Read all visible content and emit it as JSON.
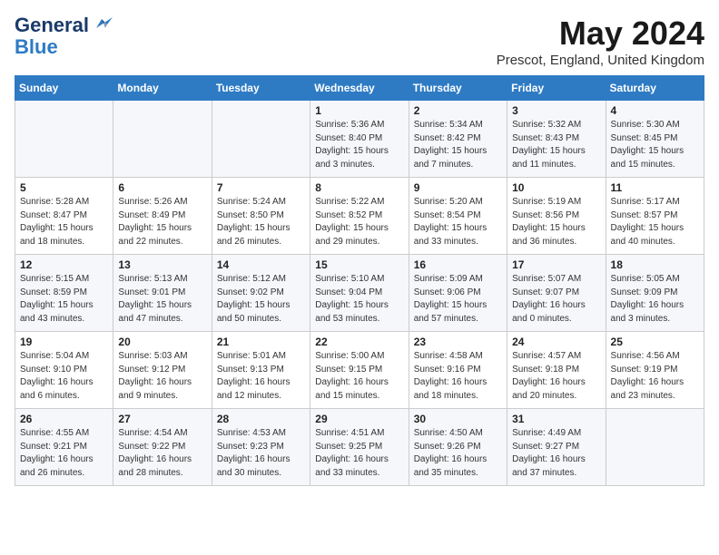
{
  "logo": {
    "line1": "General",
    "line2": "Blue"
  },
  "title": "May 2024",
  "location": "Prescot, England, United Kingdom",
  "days_header": [
    "Sunday",
    "Monday",
    "Tuesday",
    "Wednesday",
    "Thursday",
    "Friday",
    "Saturday"
  ],
  "weeks": [
    [
      {
        "day": "",
        "content": ""
      },
      {
        "day": "",
        "content": ""
      },
      {
        "day": "",
        "content": ""
      },
      {
        "day": "1",
        "content": "Sunrise: 5:36 AM\nSunset: 8:40 PM\nDaylight: 15 hours\nand 3 minutes."
      },
      {
        "day": "2",
        "content": "Sunrise: 5:34 AM\nSunset: 8:42 PM\nDaylight: 15 hours\nand 7 minutes."
      },
      {
        "day": "3",
        "content": "Sunrise: 5:32 AM\nSunset: 8:43 PM\nDaylight: 15 hours\nand 11 minutes."
      },
      {
        "day": "4",
        "content": "Sunrise: 5:30 AM\nSunset: 8:45 PM\nDaylight: 15 hours\nand 15 minutes."
      }
    ],
    [
      {
        "day": "5",
        "content": "Sunrise: 5:28 AM\nSunset: 8:47 PM\nDaylight: 15 hours\nand 18 minutes."
      },
      {
        "day": "6",
        "content": "Sunrise: 5:26 AM\nSunset: 8:49 PM\nDaylight: 15 hours\nand 22 minutes."
      },
      {
        "day": "7",
        "content": "Sunrise: 5:24 AM\nSunset: 8:50 PM\nDaylight: 15 hours\nand 26 minutes."
      },
      {
        "day": "8",
        "content": "Sunrise: 5:22 AM\nSunset: 8:52 PM\nDaylight: 15 hours\nand 29 minutes."
      },
      {
        "day": "9",
        "content": "Sunrise: 5:20 AM\nSunset: 8:54 PM\nDaylight: 15 hours\nand 33 minutes."
      },
      {
        "day": "10",
        "content": "Sunrise: 5:19 AM\nSunset: 8:56 PM\nDaylight: 15 hours\nand 36 minutes."
      },
      {
        "day": "11",
        "content": "Sunrise: 5:17 AM\nSunset: 8:57 PM\nDaylight: 15 hours\nand 40 minutes."
      }
    ],
    [
      {
        "day": "12",
        "content": "Sunrise: 5:15 AM\nSunset: 8:59 PM\nDaylight: 15 hours\nand 43 minutes."
      },
      {
        "day": "13",
        "content": "Sunrise: 5:13 AM\nSunset: 9:01 PM\nDaylight: 15 hours\nand 47 minutes."
      },
      {
        "day": "14",
        "content": "Sunrise: 5:12 AM\nSunset: 9:02 PM\nDaylight: 15 hours\nand 50 minutes."
      },
      {
        "day": "15",
        "content": "Sunrise: 5:10 AM\nSunset: 9:04 PM\nDaylight: 15 hours\nand 53 minutes."
      },
      {
        "day": "16",
        "content": "Sunrise: 5:09 AM\nSunset: 9:06 PM\nDaylight: 15 hours\nand 57 minutes."
      },
      {
        "day": "17",
        "content": "Sunrise: 5:07 AM\nSunset: 9:07 PM\nDaylight: 16 hours\nand 0 minutes."
      },
      {
        "day": "18",
        "content": "Sunrise: 5:05 AM\nSunset: 9:09 PM\nDaylight: 16 hours\nand 3 minutes."
      }
    ],
    [
      {
        "day": "19",
        "content": "Sunrise: 5:04 AM\nSunset: 9:10 PM\nDaylight: 16 hours\nand 6 minutes."
      },
      {
        "day": "20",
        "content": "Sunrise: 5:03 AM\nSunset: 9:12 PM\nDaylight: 16 hours\nand 9 minutes."
      },
      {
        "day": "21",
        "content": "Sunrise: 5:01 AM\nSunset: 9:13 PM\nDaylight: 16 hours\nand 12 minutes."
      },
      {
        "day": "22",
        "content": "Sunrise: 5:00 AM\nSunset: 9:15 PM\nDaylight: 16 hours\nand 15 minutes."
      },
      {
        "day": "23",
        "content": "Sunrise: 4:58 AM\nSunset: 9:16 PM\nDaylight: 16 hours\nand 18 minutes."
      },
      {
        "day": "24",
        "content": "Sunrise: 4:57 AM\nSunset: 9:18 PM\nDaylight: 16 hours\nand 20 minutes."
      },
      {
        "day": "25",
        "content": "Sunrise: 4:56 AM\nSunset: 9:19 PM\nDaylight: 16 hours\nand 23 minutes."
      }
    ],
    [
      {
        "day": "26",
        "content": "Sunrise: 4:55 AM\nSunset: 9:21 PM\nDaylight: 16 hours\nand 26 minutes."
      },
      {
        "day": "27",
        "content": "Sunrise: 4:54 AM\nSunset: 9:22 PM\nDaylight: 16 hours\nand 28 minutes."
      },
      {
        "day": "28",
        "content": "Sunrise: 4:53 AM\nSunset: 9:23 PM\nDaylight: 16 hours\nand 30 minutes."
      },
      {
        "day": "29",
        "content": "Sunrise: 4:51 AM\nSunset: 9:25 PM\nDaylight: 16 hours\nand 33 minutes."
      },
      {
        "day": "30",
        "content": "Sunrise: 4:50 AM\nSunset: 9:26 PM\nDaylight: 16 hours\nand 35 minutes."
      },
      {
        "day": "31",
        "content": "Sunrise: 4:49 AM\nSunset: 9:27 PM\nDaylight: 16 hours\nand 37 minutes."
      },
      {
        "day": "",
        "content": ""
      }
    ]
  ]
}
